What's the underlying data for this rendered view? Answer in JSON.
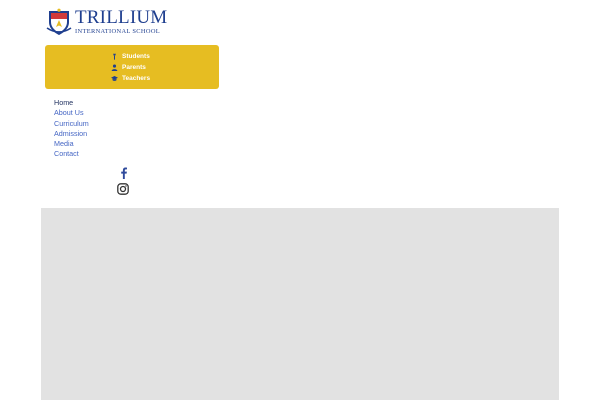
{
  "logo": {
    "name": "TRILLIUM",
    "subtitle": "INTERNATIONAL SCHOOL"
  },
  "portal": {
    "background": "#e6bd22",
    "links": [
      {
        "label": "Students",
        "icon": "torch-icon"
      },
      {
        "label": "Parents",
        "icon": "person-icon"
      },
      {
        "label": "Teachers",
        "icon": "graduation-cap-icon"
      }
    ]
  },
  "nav": {
    "items": [
      {
        "label": "Home",
        "active": true
      },
      {
        "label": "About Us",
        "active": false
      },
      {
        "label": "Curriculum",
        "active": false
      },
      {
        "label": "Admission",
        "active": false
      },
      {
        "label": "Media",
        "active": false
      },
      {
        "label": "Contact",
        "active": false
      }
    ]
  },
  "social": [
    {
      "icon": "facebook-icon"
    },
    {
      "icon": "instagram-icon"
    }
  ],
  "colors": {
    "brand_blue": "#1f3f8f",
    "link_blue": "#4566c4",
    "accent_yellow": "#e6bd22",
    "hero_gray": "#e2e2e2"
  }
}
